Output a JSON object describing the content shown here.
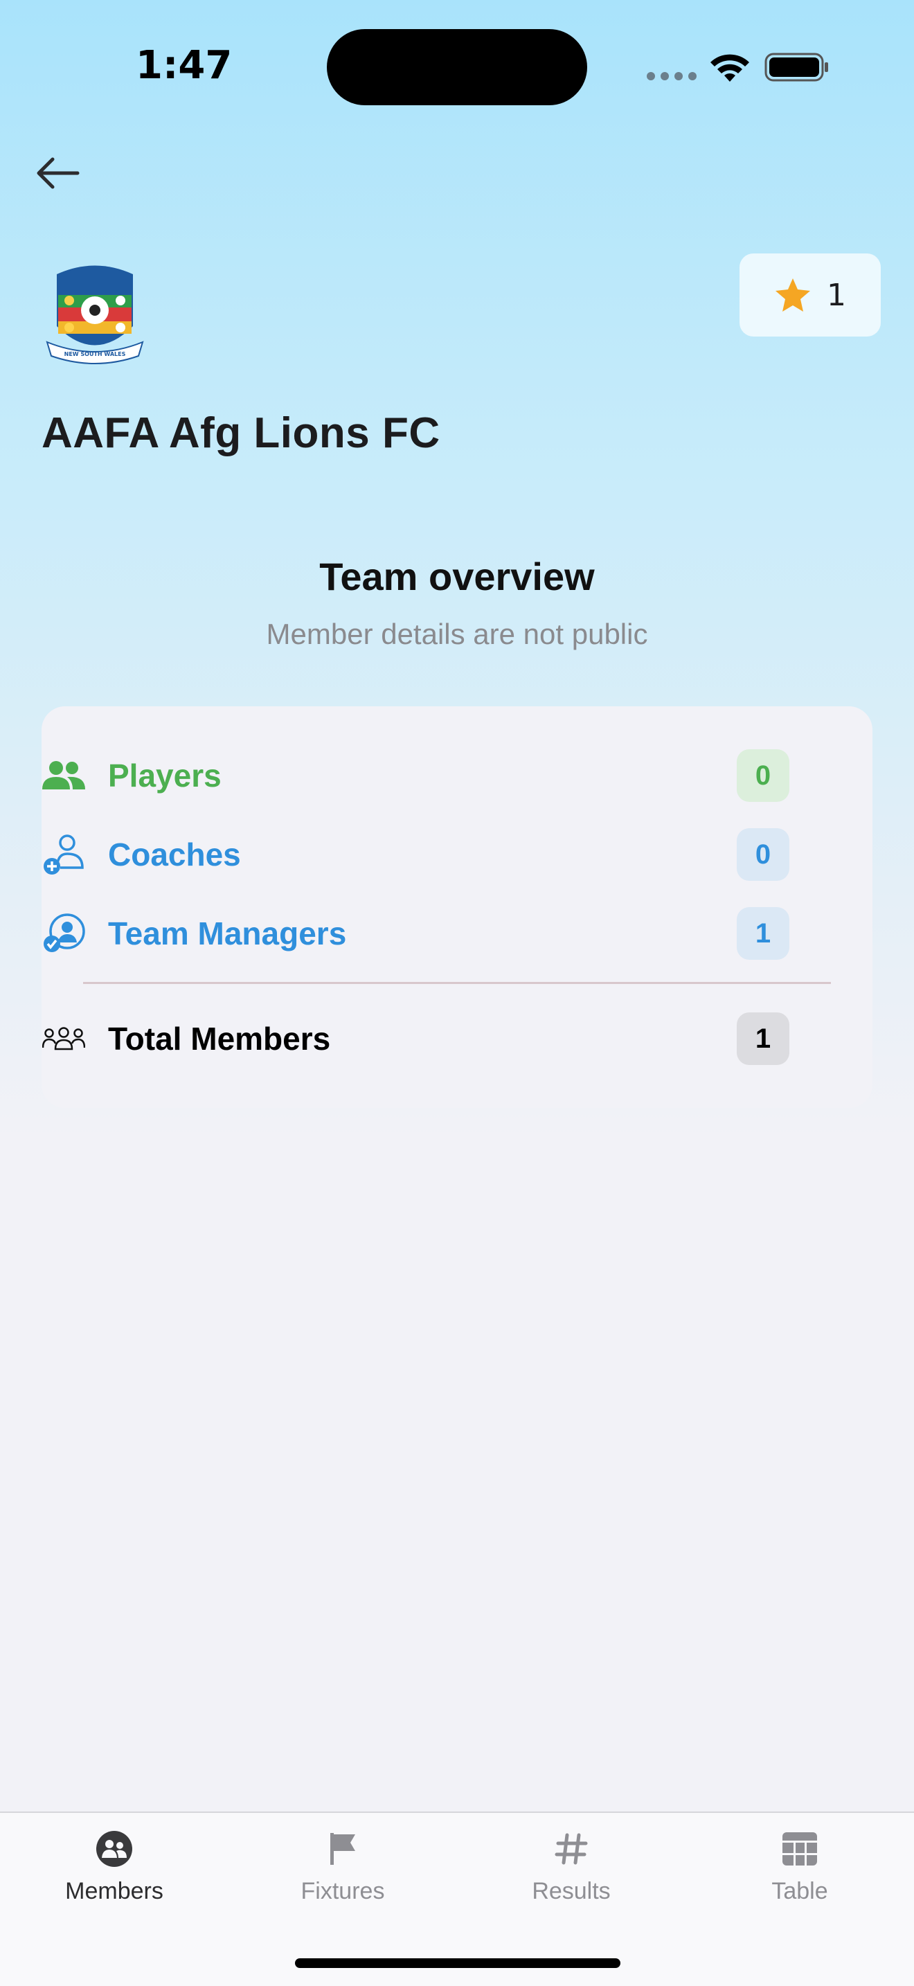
{
  "status_bar": {
    "time": "1:47"
  },
  "header": {
    "team_name": "AAFA Afg Lions FC",
    "favourites_count": "1",
    "logo_text": "NEW SOUTH WALES"
  },
  "overview": {
    "title": "Team overview",
    "subtitle": "Member details are not public"
  },
  "members": {
    "rows": [
      {
        "label": "Players",
        "count": "0"
      },
      {
        "label": "Coaches",
        "count": "0"
      },
      {
        "label": "Team Managers",
        "count": "1"
      }
    ],
    "total": {
      "label": "Total Members",
      "count": "1"
    }
  },
  "tabs": [
    {
      "label": "Members",
      "icon": "members-icon",
      "active": true
    },
    {
      "label": "Fixtures",
      "icon": "flag-icon",
      "active": false
    },
    {
      "label": "Results",
      "icon": "hash-icon",
      "active": false
    },
    {
      "label": "Table",
      "icon": "table-icon",
      "active": false
    }
  ],
  "colors": {
    "players": "#4caf50",
    "staff": "#2f8fdc",
    "star": "#f5a623"
  }
}
